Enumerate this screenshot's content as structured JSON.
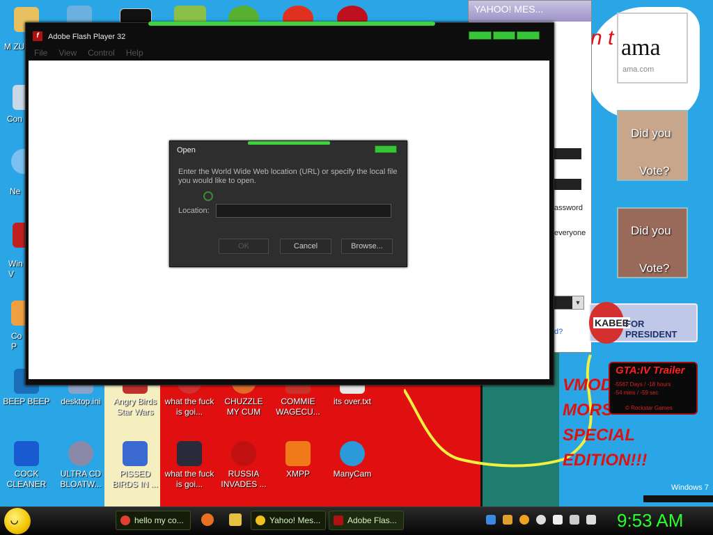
{
  "flash_window": {
    "title": "Adobe Flash Player 32",
    "menu": [
      "File",
      "View",
      "Control",
      "Help"
    ]
  },
  "open_dialog": {
    "title": "Open",
    "prompt": "Enter the World Wide Web location (URL) or specify the local file you would like to open.",
    "location_label": "Location:",
    "location_value": "",
    "ok_label": "OK",
    "cancel_label": "Cancel",
    "browse_label": "Browse..."
  },
  "yahoo_window": {
    "title": "YAHOO! MES...",
    "password_text": "assword",
    "everyone_text": "everyone",
    "link_text": "d?"
  },
  "desktop_icons_top_row": [
    {
      "label": "BEEP BEEP",
      "icon": "file-icon",
      "color": "#1a6fb8"
    },
    {
      "label": "desktop.ini",
      "icon": "settings-file-icon",
      "color": "#8aa4c8"
    },
    {
      "label": "Angry Birds Star Wars",
      "icon": "angry-birds-icon",
      "color": "#c0302a"
    },
    {
      "label": "what the fuck is goi...",
      "icon": "angry-birds-icon",
      "color": "#d03030"
    },
    {
      "label": "CHUZZLE MY CUM",
      "icon": "chuzzle-icon",
      "color": "#e06a2a"
    },
    {
      "label": "COMMIE WAGECU...",
      "icon": "file-icon",
      "color": "#c8322a"
    },
    {
      "label": "its over.txt",
      "icon": "text-file-icon",
      "color": "#e8e8e8"
    }
  ],
  "desktop_icons_bottom_row": [
    {
      "label": "COCK CLEANER",
      "icon": "cleaner-icon",
      "color": "#1a5ad0"
    },
    {
      "label": "ULTRA CD BLOATW...",
      "icon": "cd-icon",
      "color": "#8a8aa8"
    },
    {
      "label": "PISSED BIRDS IN ...",
      "icon": "angry-birds-icon",
      "color": "#3a6ad0"
    },
    {
      "label": "what the fuck is goi...",
      "icon": "angry-birds-space-icon",
      "color": "#2a2a3a"
    },
    {
      "label": "RUSSIA INVADES ...",
      "icon": "radiation-icon",
      "color": "#c01010"
    },
    {
      "label": "XMPP",
      "icon": "xampp-icon",
      "color": "#f07a1a"
    },
    {
      "label": "ManyCam",
      "icon": "manycam-icon",
      "color": "#2a9ad8"
    }
  ],
  "desktop_icons_left_column": [
    {
      "label": "M ZUC",
      "icon": "folder-icon"
    },
    {
      "label": "Con",
      "icon": "computer-icon"
    },
    {
      "label": "Ne",
      "icon": "network-icon"
    },
    {
      "label": "Win V",
      "icon": "recycle-bin-icon"
    },
    {
      "label": "Co P",
      "icon": "control-panel-icon"
    }
  ],
  "gadgets": {
    "amazon_big": "ama",
    "amazon_small": "ama.com",
    "vote_line1": "Did you",
    "vote_line2": "Vote?",
    "huckabee_name": "KABEE",
    "huckabee_suffix": "FOR PRESIDENT",
    "gta_title": "GTA:IV Trailer",
    "gta_line1": "-5567 Days / -18 hours",
    "gta_line2": "-54 mins / -59 sec",
    "gta_line3": "© Rockstar Games"
  },
  "wallpaper_text": {
    "red_lines": [
      "VMOD",
      "MORS",
      "SPECIAL",
      "EDITION!!!"
    ],
    "banner": "n t",
    "windows7": "Windows 7"
  },
  "taskbar": {
    "buttons": [
      {
        "label": "hello my co...",
        "icon": "chrome-icon",
        "color": "#e04030"
      },
      {
        "label": "Yahoo! Mes...",
        "icon": "yahoo-smiley-icon",
        "color": "#f0c020"
      },
      {
        "label": "Adobe Flas...",
        "icon": "flash-icon",
        "color": "#b01010"
      }
    ],
    "clock": "9:53 AM"
  }
}
